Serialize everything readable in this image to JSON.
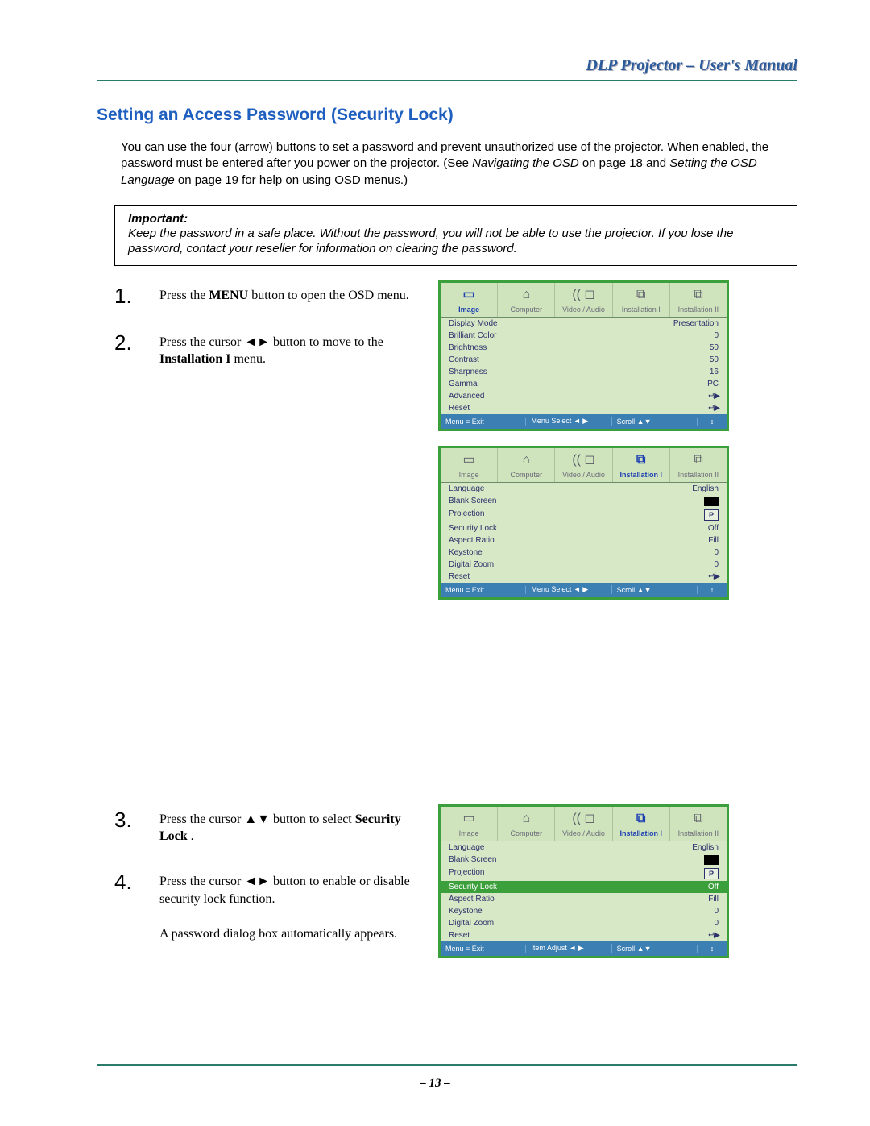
{
  "header": {
    "title": "DLP Projector – User's Manual"
  },
  "section_title": "Setting an Access Password (Security Lock)",
  "intro": {
    "text": "You can use the four (arrow) buttons to set a password and prevent unauthorized use of the projector. When enabled, the password must be entered after you power on the projector. (See ",
    "nav_ref": "Navigating the OSD",
    "mid": " on page 18 and ",
    "lang_ref": "Setting the OSD Language",
    "tail": " on page 19 for help on using OSD menus.)"
  },
  "important": {
    "heading": "Important:",
    "body": "Keep the password in a safe place. Without the password, you will not be able to use the projector. If you lose the password, contact your reseller for information on clearing the password."
  },
  "steps": {
    "1": {
      "num": "1.",
      "a": "Press the ",
      "b": "MENU",
      "c": " button to open the OSD menu."
    },
    "2": {
      "num": "2.",
      "a": "Press the cursor ",
      "arrows": "◄►",
      "b": " button to move to the ",
      "target": "Installation I",
      "c": " menu."
    },
    "3": {
      "num": "3.",
      "a": "Press the cursor ",
      "arrows": "▲▼",
      "b": " button to select ",
      "target": "Security Lock",
      "c": "."
    },
    "4": {
      "num": "4.",
      "a": "Press the cursor ",
      "arrows": "◄►",
      "b": " button to enable or disable security lock function.",
      "extra": "A password dialog box automatically appears."
    }
  },
  "osd_tabs": [
    "Image",
    "Computer",
    "Video / Audio",
    "Installation I",
    "Installation II"
  ],
  "osd_tab_icons": [
    "▭",
    "⌂",
    "(( ◻",
    "⧉",
    "⧉"
  ],
  "osd1": {
    "active_tab": 0,
    "rows": [
      {
        "label": "Display Mode",
        "val": "Presentation"
      },
      {
        "label": "Brilliant Color",
        "val": "0"
      },
      {
        "label": "Brightness",
        "val": "50"
      },
      {
        "label": "Contrast",
        "val": "50"
      },
      {
        "label": "Sharpness",
        "val": "16"
      },
      {
        "label": "Gamma",
        "val": "PC"
      },
      {
        "label": "Advanced",
        "val": "↵/▶",
        "enter": true
      },
      {
        "label": "Reset",
        "val": "↵/▶",
        "enter": true
      }
    ],
    "footer": [
      "Menu = Exit",
      "Menu Select ◄ ▶",
      "Scroll ▲▼",
      "↕"
    ]
  },
  "osd2": {
    "active_tab": 3,
    "rows": [
      {
        "label": "Language",
        "val": "English"
      },
      {
        "label": "Blank Screen",
        "swatch": "black"
      },
      {
        "label": "Projection",
        "swatch": "P"
      },
      {
        "label": "Security Lock",
        "val": "Off"
      },
      {
        "label": "Aspect Ratio",
        "val": "Fill"
      },
      {
        "label": "Keystone",
        "val": "0"
      },
      {
        "label": "Digital Zoom",
        "val": "0"
      },
      {
        "label": "Reset",
        "val": "↵/▶",
        "enter": true
      }
    ],
    "footer": [
      "Menu = Exit",
      "Menu Select ◄ ▶",
      "Scroll ▲▼",
      "↕"
    ]
  },
  "osd3": {
    "active_tab": 3,
    "highlight": 3,
    "rows": [
      {
        "label": "Language",
        "val": "English"
      },
      {
        "label": "Blank Screen",
        "swatch": "black"
      },
      {
        "label": "Projection",
        "swatch": "P"
      },
      {
        "label": "Security Lock",
        "val": "Off"
      },
      {
        "label": "Aspect Ratio",
        "val": "Fill"
      },
      {
        "label": "Keystone",
        "val": "0"
      },
      {
        "label": "Digital Zoom",
        "val": "0"
      },
      {
        "label": "Reset",
        "val": "↵/▶",
        "enter": true
      }
    ],
    "footer": [
      "Menu = Exit",
      "Item Adjust ◄ ▶",
      "Scroll ▲▼",
      "↕"
    ]
  },
  "page_number": "– 13 –"
}
